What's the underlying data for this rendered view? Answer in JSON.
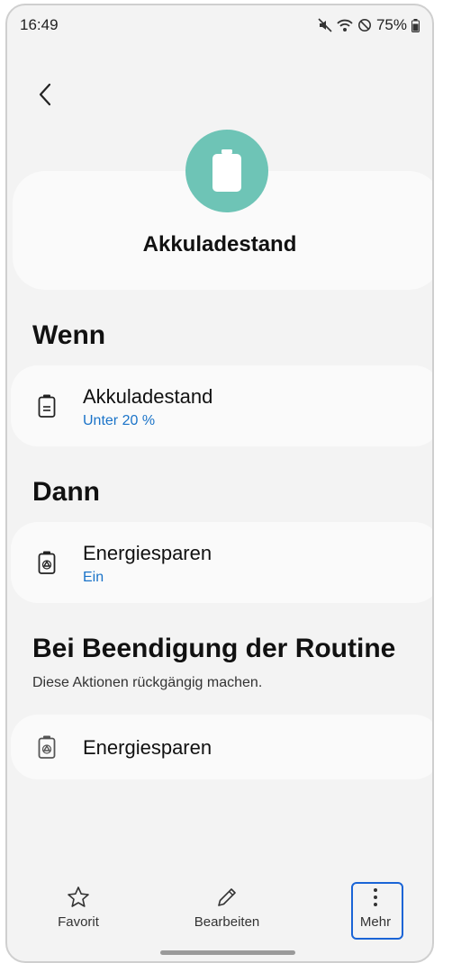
{
  "status_bar": {
    "time": "16:49",
    "battery_percent": "75%",
    "icons": [
      "mute-icon",
      "wifi-icon",
      "do-not-disturb-icon",
      "battery-icon"
    ]
  },
  "header": {
    "title": "Akkuladestand",
    "accent_color": "#6ec4b6"
  },
  "sections": {
    "if": {
      "title": "Wenn",
      "item_label": "Akkuladestand",
      "item_value": "Unter 20 %"
    },
    "then": {
      "title": "Dann",
      "item_label": "Energiesparen",
      "item_value": "Ein"
    },
    "end": {
      "title": "Bei Beendigung der Routine",
      "description": "Diese Aktionen rückgängig machen.",
      "item_label": "Energiesparen"
    }
  },
  "bottom_bar": {
    "favorite_label": "Favorit",
    "edit_label": "Bearbeiten",
    "more_label": "Mehr"
  }
}
